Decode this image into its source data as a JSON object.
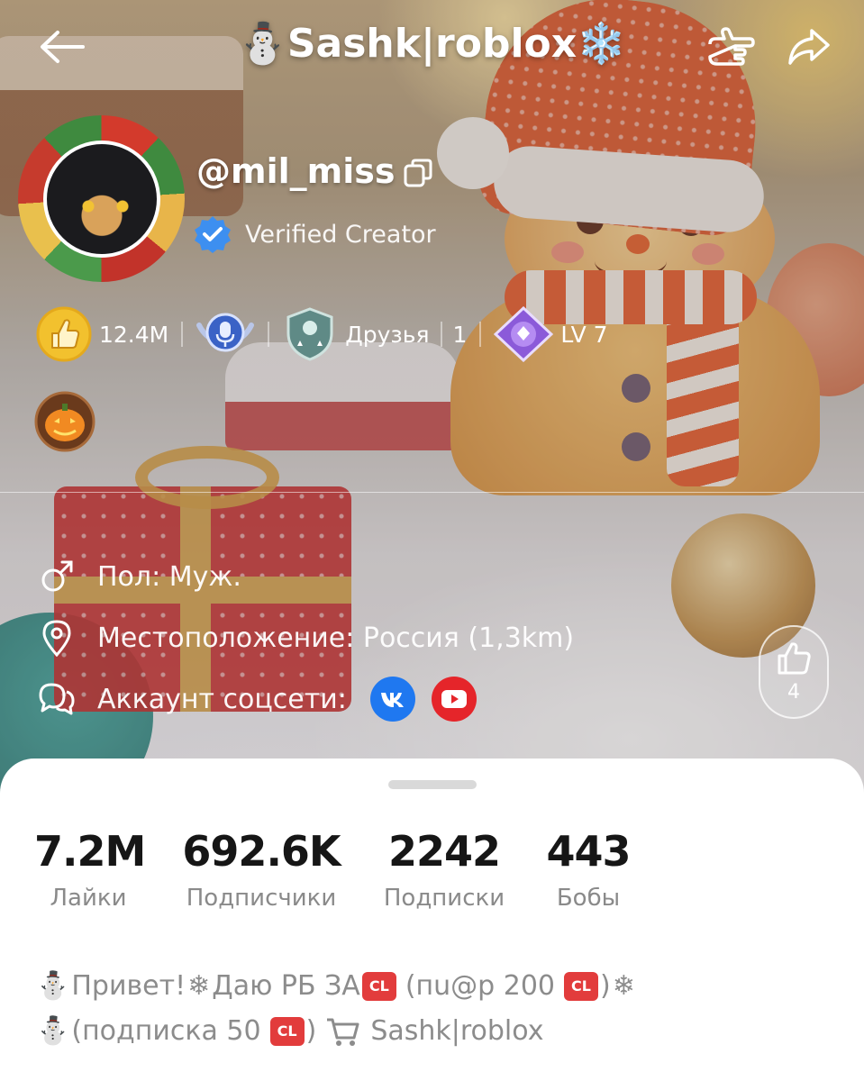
{
  "header": {
    "title": "⛄Sashk|roblox❄️"
  },
  "profile": {
    "username": "@mil_miss",
    "verified_label": "Verified Creator"
  },
  "badges": {
    "likes_count": "12.4M",
    "friends_label": "Друзья",
    "friends_count": "1",
    "level": "LV 7"
  },
  "info": {
    "gender": "Пол: Муж.",
    "location": "Местоположение: Россия (1,3km)",
    "social_label": "Аккаунт соцсети:"
  },
  "like_button": {
    "count": "4"
  },
  "stats": [
    {
      "value": "7.2M",
      "label": "Лайки"
    },
    {
      "value": "692.6K",
      "label": "Подписчики"
    },
    {
      "value": "2242",
      "label": "Подписки"
    },
    {
      "value": "443",
      "label": "Бобы"
    }
  ],
  "bio": {
    "line1_a": "Привет!",
    "line1_b": "Даю РБ ЗА",
    "line1_c": "(пu@р 200",
    "line1_d": ")",
    "line2_a": "(подписка 50",
    "line2_b": ")",
    "line2_c": "Sashk|roblox",
    "cl_label": "CL"
  },
  "colors": {
    "vk": "#1f78f0",
    "youtube": "#e5252a",
    "verified": "#3d8ff0",
    "sheet_bg": "#ffffff"
  }
}
